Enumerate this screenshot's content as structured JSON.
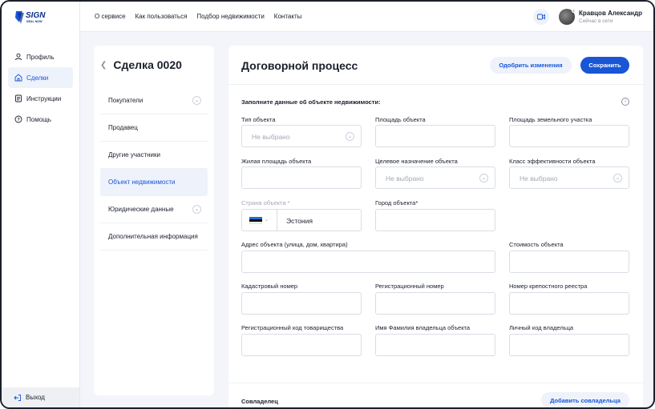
{
  "logo": {
    "text": "SIGN",
    "subtext": "DEAL NOW"
  },
  "sidebar": {
    "items": [
      {
        "label": "Профиль",
        "icon": "user-icon"
      },
      {
        "label": "Сделки",
        "icon": "home-icon"
      },
      {
        "label": "Инструкции",
        "icon": "document-icon"
      },
      {
        "label": "Помощь",
        "icon": "help-icon"
      }
    ],
    "active_index": 1,
    "logout_label": "Выход"
  },
  "header": {
    "nav": [
      "О сервисе",
      "Как пользоваться",
      "Подбор недвижимости",
      "Контакты"
    ],
    "user_name": "Кравцов Александр",
    "user_status": "Сейчас в сети"
  },
  "deal": {
    "title": "Сделка 0020",
    "steps": [
      {
        "label": "Покупатели",
        "has_dropdown": true
      },
      {
        "label": "Продавец",
        "has_dropdown": false
      },
      {
        "label": "Другие участники",
        "has_dropdown": false
      },
      {
        "label": "Объект недвижимости",
        "has_dropdown": false,
        "active": true
      },
      {
        "label": "Юридические данные",
        "has_dropdown": true
      },
      {
        "label": "Дополнительная информация",
        "has_dropdown": false
      }
    ]
  },
  "main": {
    "title": "Договорной процесс",
    "approve_label": "Одобрить изменения",
    "save_label": "Сохранить",
    "section_title": "Заполните данные об объекте недвижимости:",
    "fields": {
      "object_type": {
        "label": "Тип объекта",
        "value": "Не выбрано"
      },
      "object_area": {
        "label": "Площадь объекта",
        "value": ""
      },
      "land_area": {
        "label": "Площадь земельного участка",
        "value": ""
      },
      "living_area": {
        "label": "Жилая площадь объекта",
        "value": ""
      },
      "purpose": {
        "label": "Целевое назначение объекта",
        "value": "Не выбрано"
      },
      "efficiency_class": {
        "label": "Класс эффективности объекта",
        "value": "Не выбрано"
      },
      "country": {
        "label": "Страна объекта *",
        "value": "Эстония"
      },
      "city": {
        "label": "Город объекта*",
        "value": ""
      },
      "address": {
        "label": "Адрес объекта (улица, дом, квартира)",
        "value": ""
      },
      "price": {
        "label": "Стоимость объекта",
        "value": ""
      },
      "cadastral": {
        "label": "Кадастровый номер",
        "value": ""
      },
      "registration": {
        "label": "Регистрационный номер",
        "value": ""
      },
      "land_registry": {
        "label": "Номер крепостного реестра",
        "value": ""
      },
      "partnership_code": {
        "label": "Регистрационный код товарищества",
        "value": ""
      },
      "owner_name": {
        "label": "Имя Фамилия владельца объекта",
        "value": ""
      },
      "owner_code": {
        "label": "Личный код владельца",
        "value": ""
      }
    },
    "co_owner_title": "Совладелец",
    "add_co_owner_label": "Добавить совладельца"
  },
  "colors": {
    "accent": "#1856d6",
    "flag_blue": "#1f6fd1",
    "flag_black": "#111111",
    "flag_white": "#ffffff"
  }
}
